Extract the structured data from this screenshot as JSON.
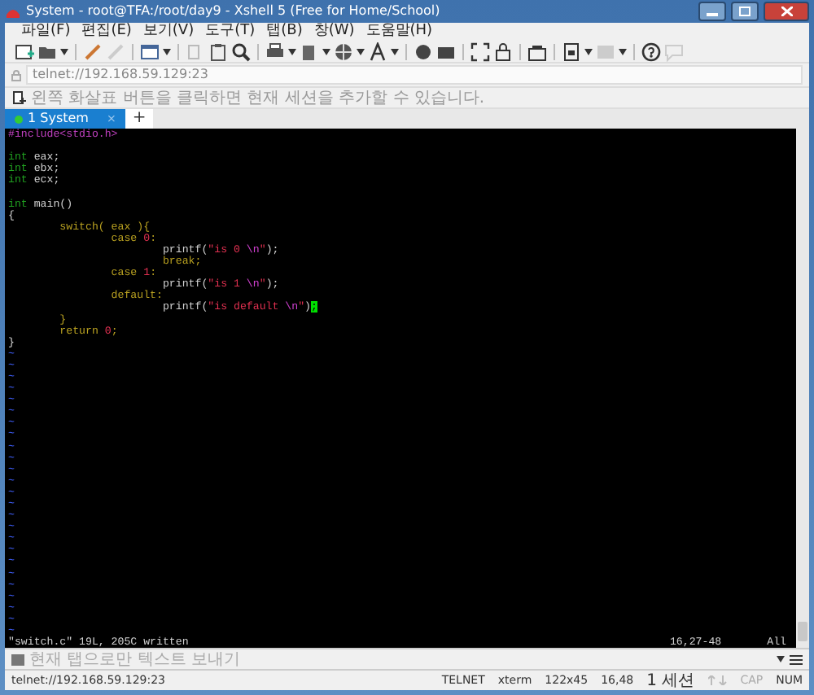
{
  "window": {
    "title": "System - root@TFA:/root/day9 - Xshell 5 (Free for Home/School)"
  },
  "menu": [
    "파일(F)",
    "편집(E)",
    "보기(V)",
    "도구(T)",
    "탭(B)",
    "창(W)",
    "도움말(H)"
  ],
  "address_bar": {
    "value": "telnet://192.168.59.129:23"
  },
  "hint_bar": {
    "text": "왼쪽 화살표 버튼을 클릭하면 현재 세션을 추가할 수 있습니다."
  },
  "tabs": [
    {
      "label": "1 System",
      "selected": true,
      "connected": true,
      "close": "×"
    }
  ],
  "new_tab": "+",
  "terminal": {
    "lines": [
      {
        "kind": "code",
        "segments": [
          {
            "text": "#include<stdio.h>",
            "kind": "preproc"
          }
        ]
      },
      {
        "kind": "blank"
      },
      {
        "kind": "code",
        "segments": [
          {
            "text": "int",
            "kind": "type"
          },
          {
            "text": " eax;",
            "kind": "plain"
          }
        ]
      },
      {
        "kind": "code",
        "segments": [
          {
            "text": "int",
            "kind": "type"
          },
          {
            "text": " ebx;",
            "kind": "plain"
          }
        ]
      },
      {
        "kind": "code",
        "segments": [
          {
            "text": "int",
            "kind": "type"
          },
          {
            "text": " ecx;",
            "kind": "plain"
          }
        ]
      },
      {
        "kind": "blank"
      },
      {
        "kind": "code",
        "segments": [
          {
            "text": "int",
            "kind": "type"
          },
          {
            "text": " main()",
            "kind": "plain"
          }
        ]
      },
      {
        "kind": "code",
        "segments": [
          {
            "text": "{",
            "kind": "plain"
          }
        ]
      },
      {
        "kind": "code",
        "segments": [
          {
            "text": "        switch( eax ){",
            "kind": "statement"
          }
        ]
      },
      {
        "kind": "code",
        "segments": [
          {
            "text": "                case ",
            "kind": "statement"
          },
          {
            "text": "0",
            "kind": "number"
          },
          {
            "text": ":",
            "kind": "statement"
          }
        ]
      },
      {
        "kind": "code",
        "segments": [
          {
            "text": "                        printf(",
            "kind": "plain"
          },
          {
            "text": "\"is 0 ",
            "kind": "string"
          },
          {
            "text": "\\n",
            "kind": "special"
          },
          {
            "text": "\"",
            "kind": "string"
          },
          {
            "text": ");",
            "kind": "plain"
          }
        ]
      },
      {
        "kind": "code",
        "segments": [
          {
            "text": "                        break;",
            "kind": "statement"
          }
        ]
      },
      {
        "kind": "code",
        "segments": [
          {
            "text": "                case ",
            "kind": "statement"
          },
          {
            "text": "1",
            "kind": "number"
          },
          {
            "text": ":",
            "kind": "statement"
          }
        ]
      },
      {
        "kind": "code",
        "segments": [
          {
            "text": "                        printf(",
            "kind": "plain"
          },
          {
            "text": "\"is 1 ",
            "kind": "string"
          },
          {
            "text": "\\n",
            "kind": "special"
          },
          {
            "text": "\"",
            "kind": "string"
          },
          {
            "text": ");",
            "kind": "plain"
          }
        ]
      },
      {
        "kind": "code",
        "segments": [
          {
            "text": "                default:",
            "kind": "statement"
          }
        ]
      },
      {
        "kind": "code",
        "segments": [
          {
            "text": "                        printf(",
            "kind": "plain"
          },
          {
            "text": "\"is default ",
            "kind": "string"
          },
          {
            "text": "\\n",
            "kind": "special"
          },
          {
            "text": "\"",
            "kind": "string"
          },
          {
            "text": ")",
            "kind": "plain"
          },
          {
            "text": ";",
            "kind": "cursor"
          }
        ]
      },
      {
        "kind": "code",
        "segments": [
          {
            "text": "        }",
            "kind": "statement"
          }
        ]
      },
      {
        "kind": "code",
        "segments": [
          {
            "text": "        return ",
            "kind": "statement"
          },
          {
            "text": "0",
            "kind": "number"
          },
          {
            "text": ";",
            "kind": "statement"
          }
        ]
      },
      {
        "kind": "code",
        "segments": [
          {
            "text": "}",
            "kind": "plain"
          }
        ]
      }
    ],
    "tildes": [
      "~",
      "~",
      "~",
      "~",
      "~",
      "~",
      "~",
      "~",
      "~",
      "~",
      "~",
      "~",
      "~",
      "~",
      "~",
      "~",
      "~",
      "~",
      "~",
      "~",
      "~",
      "~",
      "~",
      "~",
      "~"
    ],
    "message": "\"switch.c\" 19L, 205C written",
    "position": "16,27-48",
    "scroll": "All"
  },
  "compose_bar": {
    "placeholder": "현재 탭으로만 텍스트 보내기"
  },
  "status_bar": {
    "address": "telnet://192.168.59.129:23",
    "protocol": "TELNET",
    "terminal_type": "xterm",
    "size": "122x45",
    "cursor": "16,48",
    "sessions": "1 세션",
    "caps": "CAP",
    "num": "NUM"
  }
}
